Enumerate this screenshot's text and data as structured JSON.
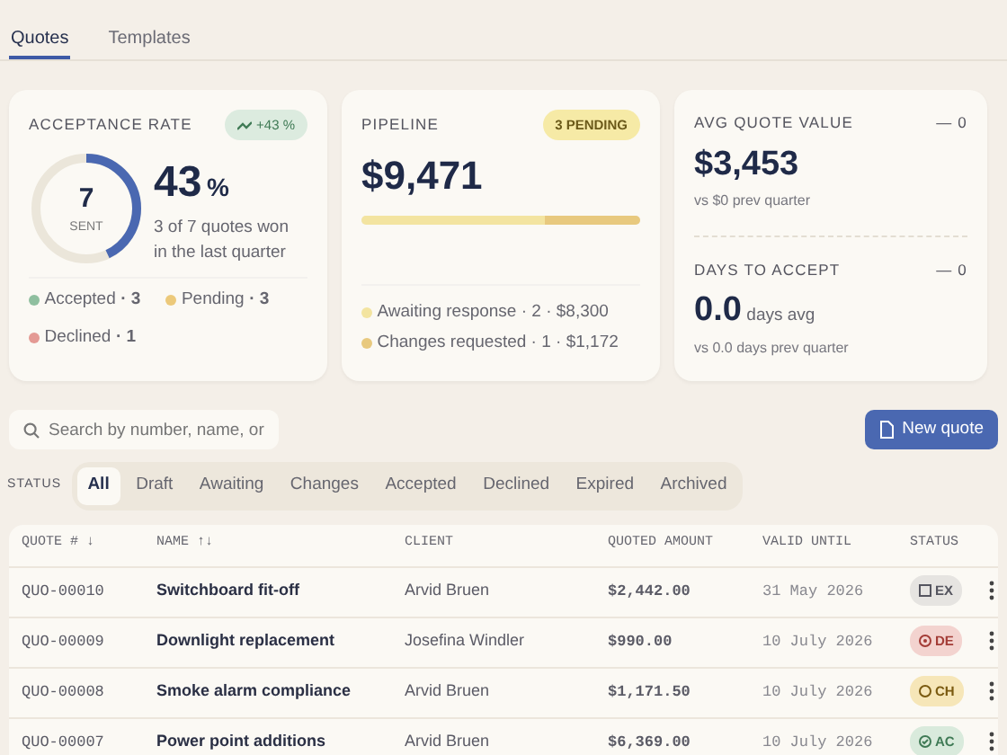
{
  "tabs": [
    {
      "label": "Quotes",
      "selected": true
    },
    {
      "label": "Templates",
      "selected": false
    }
  ],
  "acceptance": {
    "title": "ACCEPTANCE RATE",
    "trend": "+43 %",
    "sent": "7",
    "sent_label": "SENT",
    "level": 0.43,
    "rate": "43",
    "unit": "%",
    "caption": "3 of 7 quotes won in the last quarter",
    "legend": [
      {
        "label": "Accepted",
        "count": "· 3",
        "color": "#8fbf9f"
      },
      {
        "label": "Pending",
        "count": "· 3",
        "color": "#ecc97a"
      },
      {
        "label": "Declined",
        "count": "· 1",
        "color": "#e49a94"
      }
    ]
  },
  "pipeline": {
    "title": "PIPELINE",
    "badge": "3 PENDING",
    "amount": "$9,471",
    "segments": [
      {
        "label": "Awaiting response · 2 · $8,300",
        "color": "#f3e4a0",
        "level": 0.66
      },
      {
        "label": "Changes requested · 1 · $1,172",
        "color": "#e8c97e",
        "level": 0.34
      }
    ]
  },
  "stats": [
    {
      "title": "AVG QUOTE VALUE",
      "delta": "— 0",
      "value": "$3,453",
      "sub": "vs $0 prev quarter"
    },
    {
      "title": "DAYS TO ACCEPT",
      "delta": "— 0",
      "value": "0.0",
      "suffix": "days avg",
      "sub": "vs 0.0 days prev quarter"
    }
  ],
  "search": {
    "placeholder": "Search by number, name, or"
  },
  "new_button": "New quote",
  "filter": {
    "label": "STATUS",
    "options": [
      {
        "label": "All",
        "selected": true
      },
      {
        "label": "Draft",
        "selected": false
      },
      {
        "label": "Awaiting",
        "selected": false
      },
      {
        "label": "Changes",
        "selected": false
      },
      {
        "label": "Accepted",
        "selected": false
      },
      {
        "label": "Declined",
        "selected": false
      },
      {
        "label": "Expired",
        "selected": false
      },
      {
        "label": "Archived",
        "selected": false
      }
    ]
  },
  "table": {
    "columns": [
      "QUOTE # ↓",
      "NAME ↑↓",
      "CLIENT",
      "QUOTED AMOUNT",
      "VALID UNTIL",
      "STATUS"
    ],
    "rows": [
      {
        "number": "QUO-00010",
        "name": "Switchboard fit-off",
        "client": "Arvid Bruen",
        "amount": "$2,442.00",
        "valid": "31 May 2026",
        "status": {
          "kind": "expired",
          "label": "EX"
        }
      },
      {
        "number": "QUO-00009",
        "name": "Downlight replacement",
        "client": "Josefina Windler",
        "amount": "$990.00",
        "valid": "10 July 2026",
        "status": {
          "kind": "declined",
          "label": "DE"
        }
      },
      {
        "number": "QUO-00008",
        "name": "Smoke alarm compliance",
        "client": "Arvid Bruen",
        "amount": "$1,171.50",
        "valid": "10 July 2026",
        "status": {
          "kind": "changes",
          "label": "CH"
        }
      },
      {
        "number": "QUO-00007",
        "name": "Power point additions",
        "client": "Arvid Bruen",
        "amount": "$6,369.00",
        "valid": "10 July 2026",
        "status": {
          "kind": "accepted",
          "label": "AC"
        }
      }
    ]
  }
}
